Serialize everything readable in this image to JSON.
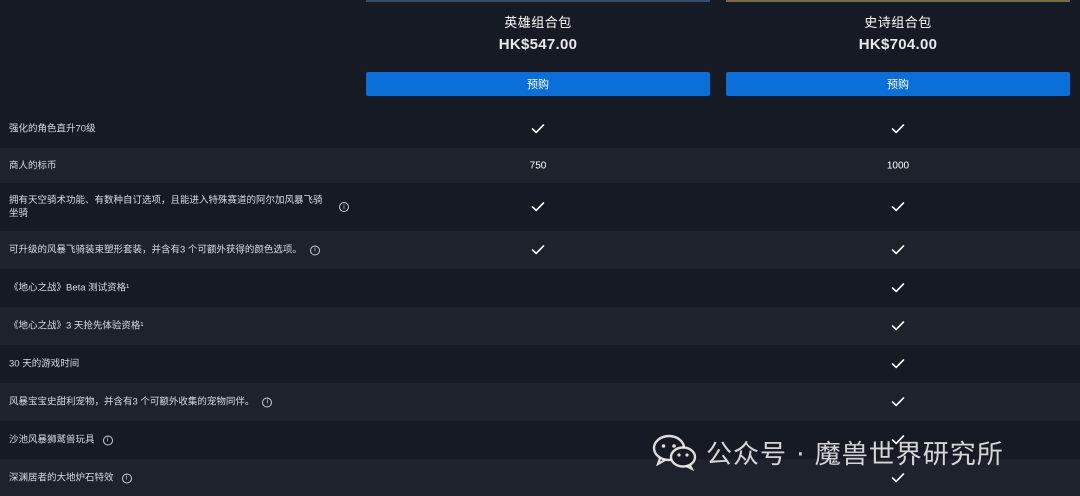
{
  "products": [
    {
      "name": "英雄组合包",
      "price": "HK$547.00",
      "button": "预购"
    },
    {
      "name": "史诗组合包",
      "price": "HK$704.00",
      "button": "预购"
    }
  ],
  "features": [
    {
      "label": "强化的角色直升70级",
      "info": false,
      "hero": "check",
      "epic": "check"
    },
    {
      "label": "商人的标币",
      "info": false,
      "hero": "750",
      "epic": "1000"
    },
    {
      "label": "拥有天空骑术功能、有数种自订选项，且能进入特殊赛道的阿尔加风暴飞骑坐骑",
      "info": true,
      "hero": "check",
      "epic": "check"
    },
    {
      "label": "可升级的风暴飞骑装束塑形套装，并含有3 个可额外获得的颜色选项。",
      "info": true,
      "hero": "check",
      "epic": "check"
    },
    {
      "label": "《地心之战》Beta 测试资格¹",
      "info": false,
      "hero": "",
      "epic": "check"
    },
    {
      "label": "《地心之战》3 天抢先体验资格¹",
      "info": false,
      "hero": "",
      "epic": "check"
    },
    {
      "label": "30 天的游戏时间",
      "info": false,
      "hero": "",
      "epic": "check"
    },
    {
      "label": "风暴宝宝史甜利宠物，并含有3 个可额外收集的宠物同伴。",
      "info": true,
      "hero": "",
      "epic": "check"
    },
    {
      "label": "沙池风暴狮鹫兽玩具",
      "info": true,
      "hero": "",
      "epic": "check"
    },
    {
      "label": "深渊居者的大地炉石特效",
      "info": true,
      "hero": "",
      "epic": "check"
    }
  ],
  "watermark": {
    "text": "公众号 · 魔兽世界研究所"
  },
  "colors": {
    "accent": "#0a6fd8",
    "background": "#151a25",
    "stripe": "#1d222d"
  }
}
